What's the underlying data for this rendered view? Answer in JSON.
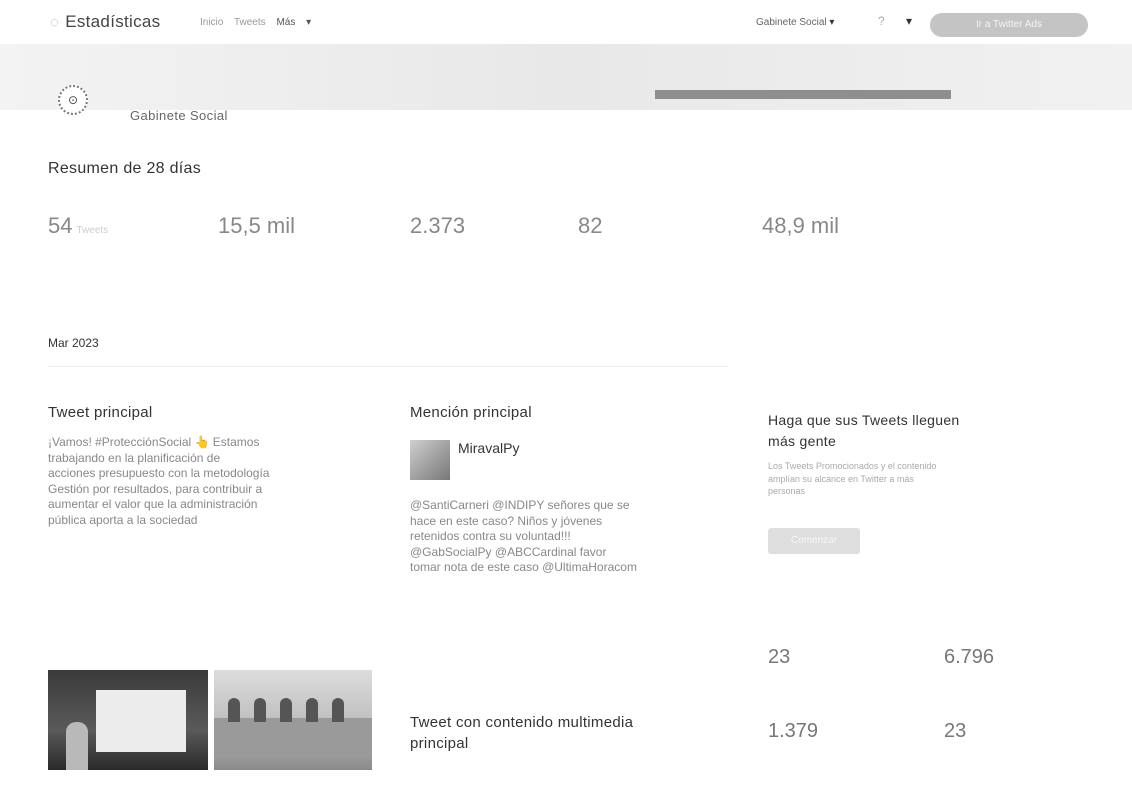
{
  "nav": {
    "brand_icon": "◌",
    "brand": "Estadísticas",
    "links": [
      "Inicio",
      "Tweets"
    ],
    "more": "Más",
    "account": "Gabinete Social",
    "help_icon": "?",
    "cta": "Ir a Twitter Ads"
  },
  "account": {
    "name": "Gabinete Social"
  },
  "summary": {
    "title": "Resumen de 28 días",
    "stats": [
      {
        "value": "54",
        "unit": "Tweets"
      },
      {
        "value": "15,5 mil",
        "unit": ""
      },
      {
        "value": "2.373",
        "unit": ""
      },
      {
        "value": "82",
        "unit": ""
      },
      {
        "value": "48,9 mil",
        "unit": ""
      }
    ]
  },
  "month": {
    "label": "Mar 2023"
  },
  "top_tweet": {
    "title": "Tweet principal",
    "text_lines": [
      "¡Vamos! #ProtecciónSocial 👆 Estamos",
      "trabajando en la planificación de",
      "acciones presupuesto con la metodología",
      "Gestión por resultados, para contribuir a",
      "aumentar el valor que la administración",
      "pública aporta a la sociedad"
    ]
  },
  "top_mention": {
    "title": "Mención principal",
    "name": "MiravalPy",
    "text_lines": [
      "@SantiCarneri @INDIPY señores que se",
      "hace en este caso? Niños y jóvenes",
      "retenidos contra su voluntad!!!",
      "@GabSocialPy @ABCCardinal favor",
      "tomar nota de este caso @UltimaHoracom"
    ]
  },
  "top_media": {
    "title_line1": "Tweet con contenido multimedia",
    "title_line2": "principal"
  },
  "promo": {
    "title_line1": "Haga que sus Tweets lleguen",
    "title_line2": "más gente",
    "desc_lines": [
      "Los Tweets Promocionados y el contenido",
      "amplían su alcance en Twitter a más",
      "personas"
    ],
    "button": "Comenzar",
    "stats": [
      {
        "value": "23"
      },
      {
        "value": "6.796"
      },
      {
        "value": "1.379"
      },
      {
        "value": "23"
      }
    ]
  }
}
